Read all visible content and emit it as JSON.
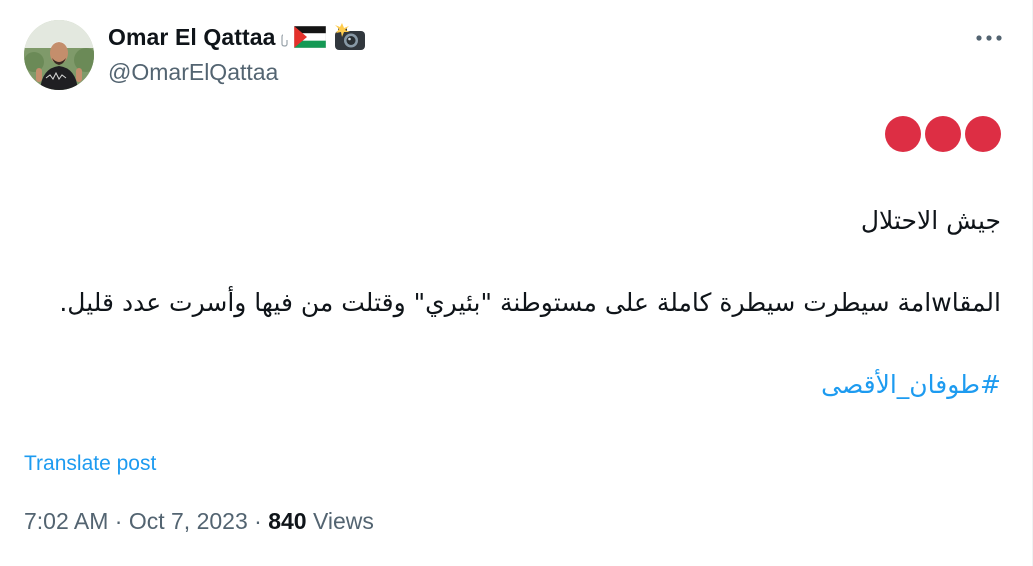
{
  "author": {
    "display_name": "Omar El Qattaa",
    "handle": "@OmarElQattaa",
    "avatar_icon": "profile-photo",
    "name_emojis": [
      "palestine-flag-icon",
      "camera-flash-icon"
    ]
  },
  "more_icon": "ellipsis-icon",
  "tweet": {
    "line_1": "جيش الاحتلال",
    "line_2": "المقاwامة سيطرت سيطرة كاملة على مستوطنة \"بئيري\" وقتلت من فيها وأسرت عدد قليل.",
    "hashtag": "#طوفان_الأقصى"
  },
  "translate_label": "Translate post",
  "meta": {
    "time": "7:02 AM",
    "separator_1": " · ",
    "date": "Oct 7, 2023",
    "separator_2": " · ",
    "views_count": "840",
    "views_label": " Views"
  },
  "colors": {
    "accent": "#1d9bf0",
    "secondary_text": "#536471",
    "dot_red": "#dd2e44"
  }
}
